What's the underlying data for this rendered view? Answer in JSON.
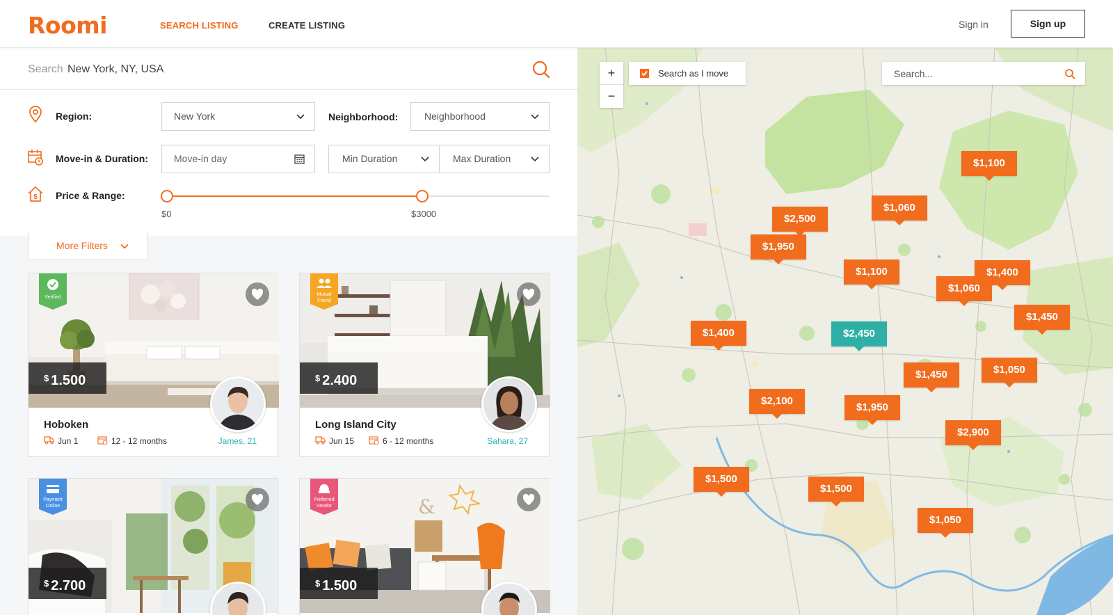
{
  "brand": {
    "name": "Roomi",
    "accent": "#f26c1d",
    "teal": "#2fb0a6"
  },
  "nav": {
    "search_listing": "SEARCH LISTING",
    "create_listing": "CREATE LISTING",
    "sign_in": "Sign in",
    "sign_up": "Sign up"
  },
  "search": {
    "prefix": "Search",
    "value": "New York, NY, USA"
  },
  "filters": {
    "region_label": "Region:",
    "region_value": "New York",
    "neighborhood_label": "Neighborhood:",
    "neighborhood_value": "Neighborhood",
    "move_label": "Move-in & Duration:",
    "move_in_placeholder": "Move-in day",
    "min_duration": "Min Duration",
    "max_duration": "Max Duration",
    "price_label": "Price & Range:",
    "price_min": "$0",
    "price_max": "$3000",
    "price_min_value": 0,
    "price_max_value": 3000,
    "more_filters": "More Filters"
  },
  "listings": [
    {
      "currency": "$",
      "price": "1.500",
      "title": "Hoboken",
      "move_in": "Jun 1",
      "duration": "12 - 12 months",
      "host": "James, 21",
      "badge": "Verified",
      "badge_color": "#5cb85c"
    },
    {
      "currency": "$",
      "price": "2.400",
      "title": "Long Island City",
      "move_in": "Jun 15",
      "duration": "6 - 12 months",
      "host": "Sahara, 27",
      "badge_line1": "Mutual",
      "badge_line2": "Friend",
      "badge_color": "#f5a623"
    },
    {
      "currency": "$",
      "price": "2.700",
      "badge_line1": "Payment",
      "badge_line2": "Online",
      "badge_color": "#4a90e2"
    },
    {
      "currency": "$",
      "price": "1.500",
      "badge_line1": "Preferred",
      "badge_line2": "Vendor",
      "badge_color": "#e8577a"
    }
  ],
  "map": {
    "zoom_in": "+",
    "zoom_out": "−",
    "search_as_move": "Search as I move",
    "search_placeholder": "Search...",
    "pins": [
      "$1,100",
      "$2,500",
      "$1,060",
      "$1,950",
      "$1,100",
      "$1,400",
      "$1,060",
      "$1,450",
      "$1,400",
      "$2,450",
      "$1,450",
      "$1,050",
      "$2,100",
      "$1,950",
      "$2,900",
      "$1,500",
      "$1,500",
      "$1,050"
    ]
  }
}
